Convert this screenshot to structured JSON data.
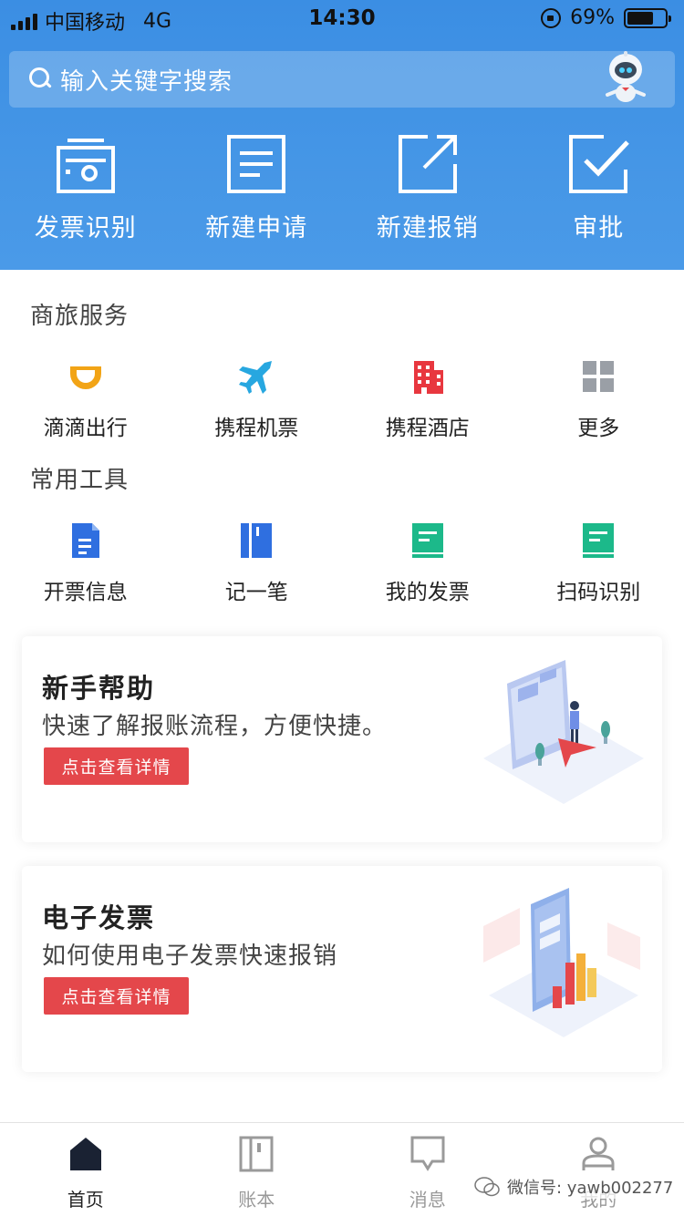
{
  "status_bar": {
    "carrier": "中国移动",
    "network": "4G",
    "time": "14:30",
    "battery": "69%",
    "battery_level": 0.69
  },
  "search": {
    "placeholder": "输入关键字搜索"
  },
  "quick_actions": [
    {
      "label": "发票识别",
      "icon": "camera-scan-icon"
    },
    {
      "label": "新建申请",
      "icon": "document-icon"
    },
    {
      "label": "新建报销",
      "icon": "external-link-icon"
    },
    {
      "label": "审批",
      "icon": "checkbox-icon"
    }
  ],
  "travel_section": {
    "title": "商旅服务",
    "items": [
      {
        "label": "滴滴出行",
        "icon": "didi-icon",
        "color": "#f2a416"
      },
      {
        "label": "携程机票",
        "icon": "airplane-icon",
        "color": "#27a7e0"
      },
      {
        "label": "携程酒店",
        "icon": "hotel-icon",
        "color": "#e8373f"
      },
      {
        "label": "更多",
        "icon": "grid-icon",
        "color": "#9a9fa6"
      }
    ]
  },
  "tools_section": {
    "title": "常用工具",
    "items": [
      {
        "label": "开票信息",
        "icon": "document-icon",
        "color": "#2f6fe0"
      },
      {
        "label": "记一笔",
        "icon": "notebook-icon",
        "color": "#2f6fe0"
      },
      {
        "label": "我的发票",
        "icon": "invoice-icon",
        "color": "#1cb98a"
      },
      {
        "label": "扫码识别",
        "icon": "scan-icon",
        "color": "#1cb98a"
      }
    ]
  },
  "cards": [
    {
      "title": "新手帮助",
      "subtitle": "快速了解报账流程，方便快捷。",
      "button": "点击查看详情"
    },
    {
      "title": "电子发票",
      "subtitle": "如何使用电子发票快速报销",
      "button": "点击查看详情"
    }
  ],
  "tab_bar": [
    {
      "label": "首页",
      "icon": "home-icon",
      "active": true
    },
    {
      "label": "账本",
      "icon": "ledger-icon",
      "active": false
    },
    {
      "label": "消息",
      "icon": "message-icon",
      "active": false
    },
    {
      "label": "我的",
      "icon": "user-icon",
      "active": false
    }
  ],
  "watermark": "微信号: yawb002277",
  "colors": {
    "header_blue": "#4596e6",
    "button_red": "#e4474b",
    "active_tab": "#1a2233"
  }
}
